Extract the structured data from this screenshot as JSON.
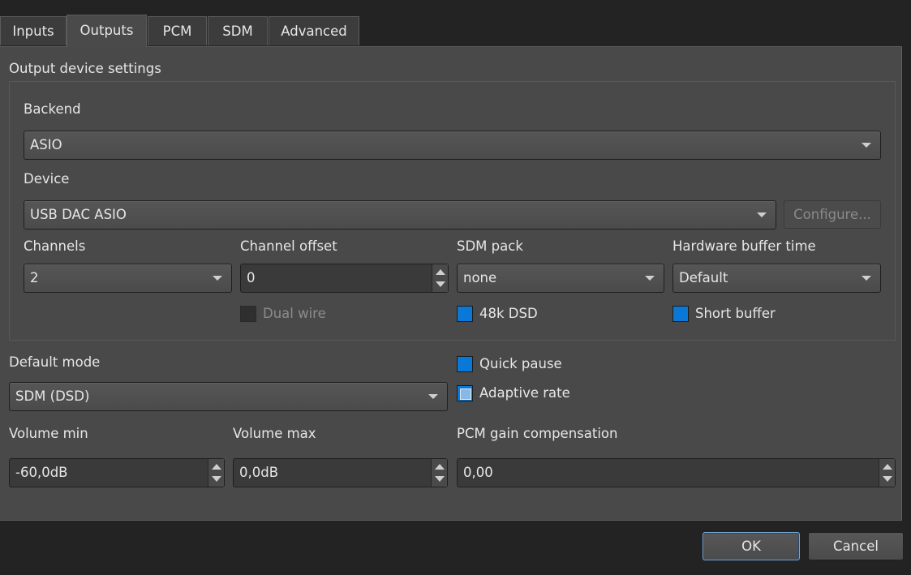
{
  "tabs": [
    {
      "label": "Inputs",
      "active": false
    },
    {
      "label": "Outputs",
      "active": true
    },
    {
      "label": "PCM",
      "active": false
    },
    {
      "label": "SDM",
      "active": false
    },
    {
      "label": "Advanced",
      "active": false
    }
  ],
  "output_settings": {
    "group_title": "Output device settings",
    "backend": {
      "label": "Backend",
      "value": "ASIO"
    },
    "device": {
      "label": "Device",
      "value": "USB DAC ASIO",
      "configure_label": "Configure..."
    },
    "channels": {
      "label": "Channels",
      "value": "2"
    },
    "channel_offset": {
      "label": "Channel offset",
      "value": "0"
    },
    "sdm_pack": {
      "label": "SDM pack",
      "value": "none"
    },
    "hardware_buffer_time": {
      "label": "Hardware buffer time",
      "value": "Default"
    },
    "dual_wire": {
      "label": "Dual wire",
      "checked": false,
      "enabled": false
    },
    "dsd_48k": {
      "label": "48k DSD",
      "checked": true
    },
    "short_buffer": {
      "label": "Short buffer",
      "checked": true
    }
  },
  "default_mode": {
    "label": "Default mode",
    "value": "SDM (DSD)"
  },
  "quick_pause": {
    "label": "Quick pause",
    "checked": true
  },
  "adaptive_rate": {
    "label": "Adaptive rate",
    "checked": "partial"
  },
  "volume_min": {
    "label": "Volume min",
    "value": "-60,0dB"
  },
  "volume_max": {
    "label": "Volume max",
    "value": "0,0dB"
  },
  "pcm_gain": {
    "label": "PCM gain compensation",
    "value": "0,00"
  },
  "dialog_buttons": {
    "ok": "OK",
    "cancel": "Cancel"
  },
  "colors": {
    "accent": "#0a78d7",
    "panel": "#494949",
    "background": "#232323"
  }
}
